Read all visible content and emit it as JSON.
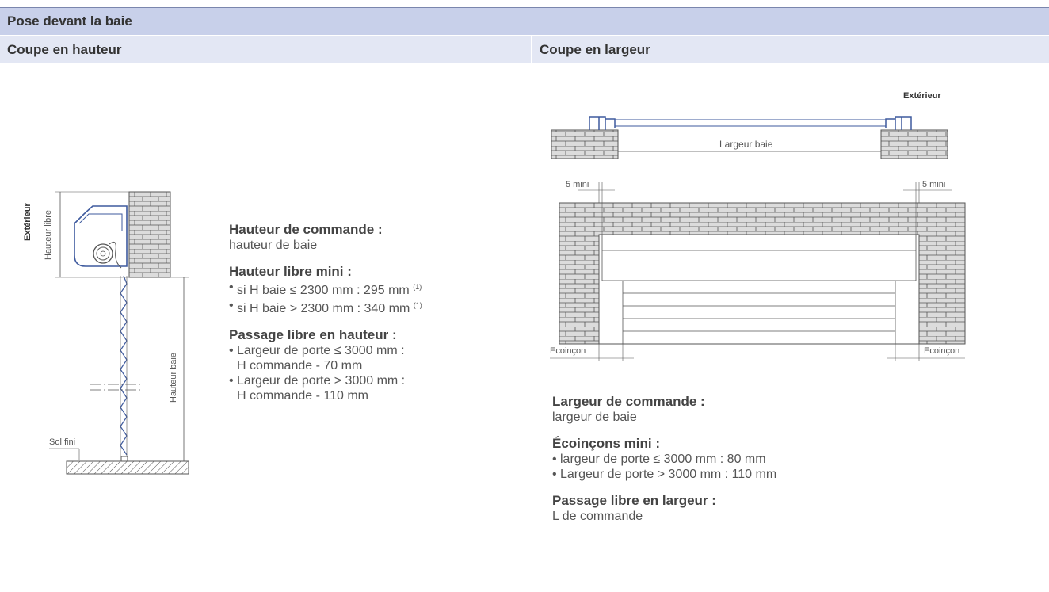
{
  "header": {
    "title": "Pose devant la baie"
  },
  "left": {
    "title": "Coupe en hauteur",
    "diagram": {
      "exterior_label": "Extérieur",
      "hauteur_libre_label": "Hauteur libre",
      "hauteur_baie_label": "Hauteur baie",
      "sol_fini_label": "Sol fini"
    },
    "sections": [
      {
        "heading": "Hauteur de commande :",
        "text": "hauteur de baie"
      },
      {
        "heading": "Hauteur libre mini :",
        "bullets": [
          {
            "text": "si H baie ≤ 2300 mm : 295 mm",
            "note": "(1)"
          },
          {
            "text": "si H baie > 2300 mm : 340 mm",
            "note": "(1)"
          }
        ]
      },
      {
        "heading": "Passage libre en hauteur :",
        "bullets": [
          {
            "line1": "Largeur de porte ≤ 3000 mm :",
            "line2": "H commande - 70 mm"
          },
          {
            "line1": "Largeur de porte > 3000 mm :",
            "line2": "H commande - 110 mm"
          }
        ]
      }
    ]
  },
  "right": {
    "title": "Coupe en largeur",
    "diagram": {
      "exterior_label": "Extérieur",
      "largeur_baie_label": "Largeur baie",
      "mini_left": "5 mini",
      "mini_right": "5 mini",
      "ecoincon_left": "Ecoinçon",
      "ecoincon_right": "Ecoinçon"
    },
    "sections": [
      {
        "heading": "Largeur de commande :",
        "text": "largeur de baie"
      },
      {
        "heading": "Écoinçons mini :",
        "bullets": [
          {
            "text": "largeur de porte ≤ 3000 mm : 80 mm"
          },
          {
            "text": "Largeur de porte > 3000 mm : 110 mm"
          }
        ]
      },
      {
        "heading": "Passage libre en largeur :",
        "text": "L de commande"
      }
    ]
  },
  "colors": {
    "header_bg": "#c8d0ea",
    "subheader_bg": "#e3e7f4",
    "accent_blue": "#3e5a9e",
    "brick_fill": "#dcdcdc",
    "line": "#555555"
  }
}
